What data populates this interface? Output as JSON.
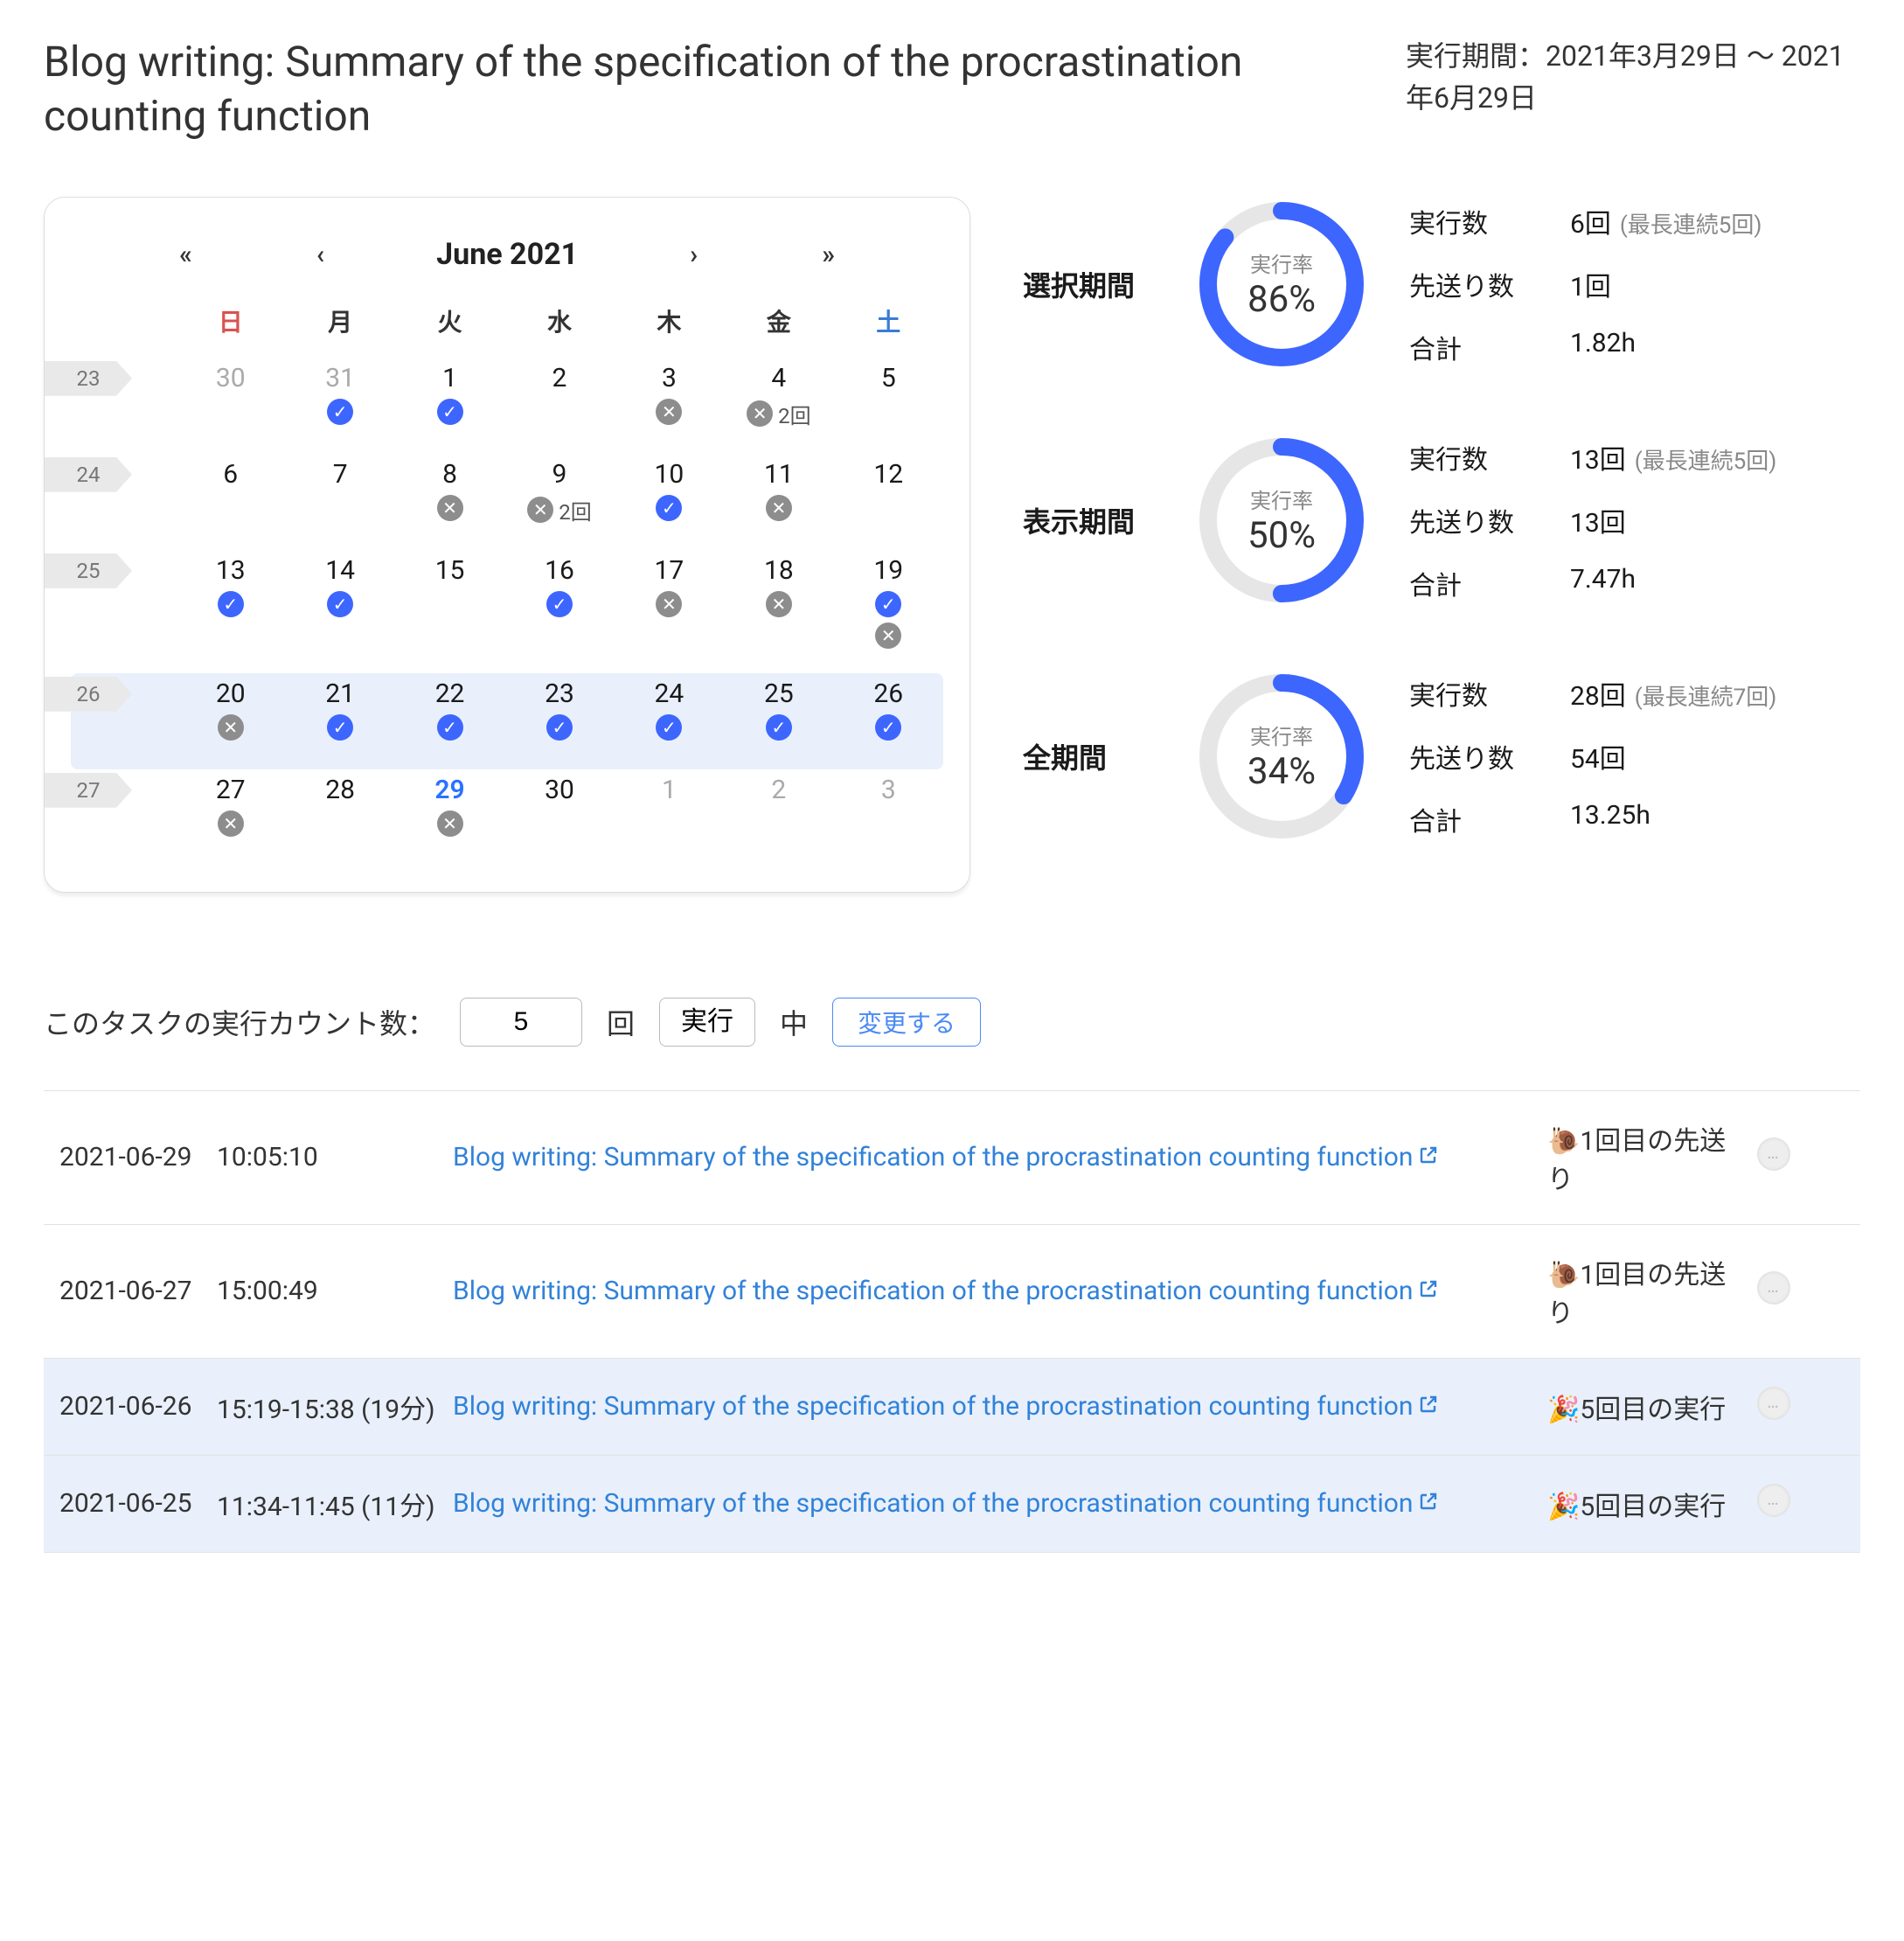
{
  "header": {
    "title": "Blog writing: Summary of the specification of the procrastination counting function",
    "period": "実行期間：2021年3月29日 〜 2021年6月29日"
  },
  "calendar": {
    "nav_prev_year": "«",
    "nav_prev_month": "‹",
    "title": "June 2021",
    "nav_next_month": "›",
    "nav_next_year": "»",
    "dow": [
      "日",
      "月",
      "火",
      "水",
      "木",
      "金",
      "土"
    ],
    "weeks": [
      {
        "label": "23",
        "highlight": false,
        "cells": [
          {
            "day": "30",
            "other": true
          },
          {
            "day": "31",
            "other": true,
            "badges": [
              {
                "type": "check"
              }
            ]
          },
          {
            "day": "1",
            "badges": [
              {
                "type": "check"
              }
            ]
          },
          {
            "day": "2"
          },
          {
            "day": "3",
            "badges": [
              {
                "type": "x"
              }
            ]
          },
          {
            "day": "4",
            "badges": [
              {
                "type": "x"
              }
            ],
            "extra": "2回"
          },
          {
            "day": "5"
          }
        ]
      },
      {
        "label": "24",
        "highlight": false,
        "cells": [
          {
            "day": "6"
          },
          {
            "day": "7"
          },
          {
            "day": "8",
            "badges": [
              {
                "type": "x"
              }
            ]
          },
          {
            "day": "9",
            "badges": [
              {
                "type": "x"
              }
            ],
            "extra": "2回"
          },
          {
            "day": "10",
            "badges": [
              {
                "type": "check"
              }
            ]
          },
          {
            "day": "11",
            "badges": [
              {
                "type": "x"
              }
            ]
          },
          {
            "day": "12"
          }
        ]
      },
      {
        "label": "25",
        "highlight": false,
        "cells": [
          {
            "day": "13",
            "badges": [
              {
                "type": "check"
              }
            ]
          },
          {
            "day": "14",
            "badges": [
              {
                "type": "check"
              }
            ]
          },
          {
            "day": "15"
          },
          {
            "day": "16",
            "badges": [
              {
                "type": "check"
              }
            ]
          },
          {
            "day": "17",
            "badges": [
              {
                "type": "x"
              }
            ]
          },
          {
            "day": "18",
            "badges": [
              {
                "type": "x"
              }
            ]
          },
          {
            "day": "19",
            "badges": [
              {
                "type": "check"
              },
              {
                "type": "x"
              }
            ]
          }
        ]
      },
      {
        "label": "26",
        "highlight": true,
        "cells": [
          {
            "day": "20",
            "badges": [
              {
                "type": "x"
              }
            ]
          },
          {
            "day": "21",
            "badges": [
              {
                "type": "check"
              }
            ]
          },
          {
            "day": "22",
            "badges": [
              {
                "type": "check"
              }
            ]
          },
          {
            "day": "23",
            "badges": [
              {
                "type": "check"
              }
            ]
          },
          {
            "day": "24",
            "badges": [
              {
                "type": "check"
              }
            ]
          },
          {
            "day": "25",
            "badges": [
              {
                "type": "check"
              }
            ]
          },
          {
            "day": "26",
            "badges": [
              {
                "type": "check"
              }
            ]
          }
        ]
      },
      {
        "label": "27",
        "highlight": false,
        "cells": [
          {
            "day": "27",
            "badges": [
              {
                "type": "x"
              }
            ]
          },
          {
            "day": "28"
          },
          {
            "day": "29",
            "today": true,
            "badges": [
              {
                "type": "x"
              }
            ]
          },
          {
            "day": "30"
          },
          {
            "day": "1",
            "other": true
          },
          {
            "day": "2",
            "other": true
          },
          {
            "day": "3",
            "other": true
          }
        ]
      }
    ]
  },
  "stats": [
    {
      "label": "選択期間",
      "rate_label": "実行率",
      "rate": "86%",
      "pct": 86,
      "rows": [
        {
          "k": "実行数",
          "v": "6回",
          "extra": "(最長連続5回)"
        },
        {
          "k": "先送り数",
          "v": "1回"
        },
        {
          "k": "合計",
          "v": "1.82h"
        }
      ]
    },
    {
      "label": "表示期間",
      "rate_label": "実行率",
      "rate": "50%",
      "pct": 50,
      "rows": [
        {
          "k": "実行数",
          "v": "13回",
          "extra": "(最長連続5回)"
        },
        {
          "k": "先送り数",
          "v": "13回"
        },
        {
          "k": "合計",
          "v": "7.47h"
        }
      ]
    },
    {
      "label": "全期間",
      "rate_label": "実行率",
      "rate": "34%",
      "pct": 34,
      "rows": [
        {
          "k": "実行数",
          "v": "28回",
          "extra": "(最長連続7回)"
        },
        {
          "k": "先送り数",
          "v": "54回"
        },
        {
          "k": "合計",
          "v": "13.25h"
        }
      ]
    }
  ],
  "controls": {
    "prefix": "このタスクの実行カウント数：",
    "count_value": "5",
    "unit": "回",
    "select_value": "実行",
    "suffix": "中",
    "button": "変更する"
  },
  "logs": [
    {
      "date": "2021-06-29",
      "time": "10:05:10",
      "title": "Blog writing: Summary of the specification of the procrastination counting function",
      "emoji": "🐌",
      "status": "1回目の先送り",
      "hl": false
    },
    {
      "date": "2021-06-27",
      "time": "15:00:49",
      "title": "Blog writing: Summary of the specification of the procrastination counting function",
      "emoji": "🐌",
      "status": "1回目の先送り",
      "hl": false
    },
    {
      "date": "2021-06-26",
      "time": "15:19-15:38 (19分)",
      "title": "Blog writing: Summary of the specification of the procrastination counting function",
      "emoji": "🎉",
      "status": "5回目の実行",
      "hl": true
    },
    {
      "date": "2021-06-25",
      "time": "11:34-11:45 (11分)",
      "title": "Blog writing: Summary of the specification of the procrastination counting function",
      "emoji": "🎉",
      "status": "5回目の実行",
      "hl": true
    }
  ]
}
